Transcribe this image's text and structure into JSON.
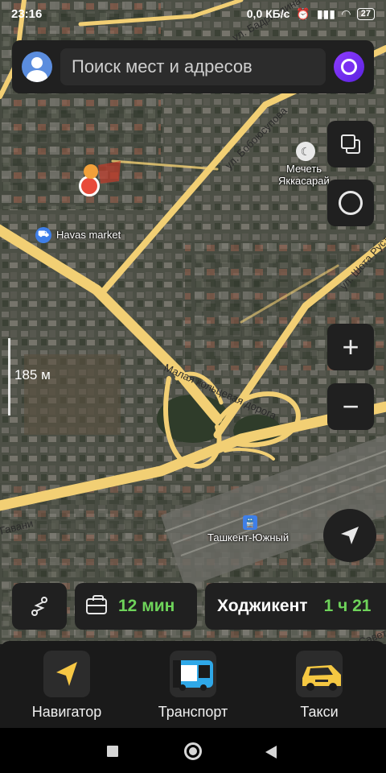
{
  "status_bar": {
    "time": "23:16",
    "network_speed": "0,0 КБ/с",
    "battery": "27"
  },
  "search": {
    "placeholder": "Поиск мест и адресов"
  },
  "map": {
    "scale_label": "185 м",
    "labels": {
      "havas": "Havas market",
      "mosque_line1": "Мечеть",
      "mosque_line2": "Яккасарай",
      "station": "Ташкент-Южный",
      "road_badriddin": "ул. Бадриддина Халила",
      "road_bobojon": "ул. Бобоюсупова",
      "road_shota": "ул. Шота Руставели",
      "road_ring": "Малая кольцевая дорога",
      "road_gavan": "Гавани",
      "road_tup": "Туп. Савета"
    }
  },
  "route_chips": {
    "work_time": "12 мин",
    "place_name": "Ходжикент",
    "place_time": "1 ч 21"
  },
  "bottom_nav": {
    "navigator": "Навигатор",
    "transport": "Транспорт",
    "taxi": "Такси"
  },
  "colors": {
    "road": "#f2cf74",
    "chip_bg": "#202020",
    "eta_green": "#6ed35a",
    "alice": "#7a2ff2"
  }
}
